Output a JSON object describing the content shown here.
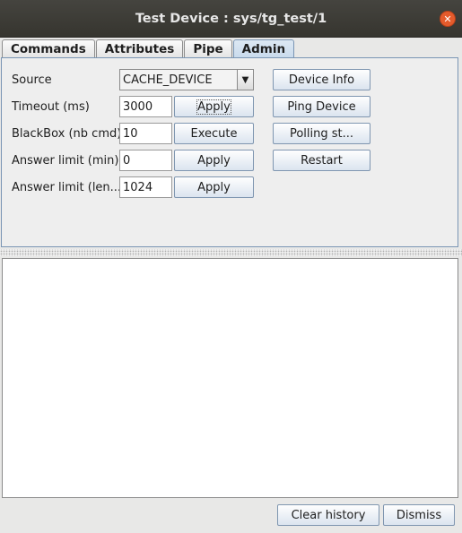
{
  "window": {
    "title": "Test Device : sys/tg_test/1"
  },
  "tabs": [
    {
      "label": "Commands"
    },
    {
      "label": "Attributes"
    },
    {
      "label": "Pipe"
    },
    {
      "label": "Admin"
    }
  ],
  "admin": {
    "source": {
      "label": "Source",
      "value": "CACHE_DEVICE"
    },
    "timeout": {
      "label": "Timeout (ms)",
      "value": "3000",
      "button": "Apply"
    },
    "blackbox": {
      "label": "BlackBox (nb cmd)",
      "value": "10",
      "button": "Execute"
    },
    "answer_min": {
      "label": "Answer limit (min)",
      "value": "0",
      "button": "Apply"
    },
    "answer_len": {
      "label": "Answer limit (len...",
      "value": "1024",
      "button": "Apply"
    },
    "device_info": "Device Info",
    "ping_device": "Ping Device",
    "polling_status": "Polling st...",
    "restart": "Restart"
  },
  "footer": {
    "clear_history": "Clear history",
    "dismiss": "Dismiss"
  },
  "icons": {
    "close": "close-icon",
    "dropdown": "chevron-down-icon"
  },
  "colors": {
    "titlebar": "#3c3b37",
    "close": "#e45b2c",
    "active_tab": "#c8daec"
  }
}
